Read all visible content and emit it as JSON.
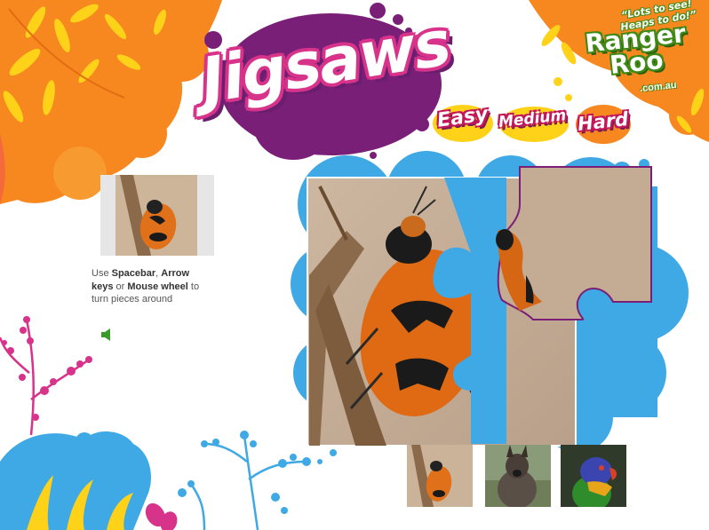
{
  "title": "Jigsaws",
  "difficulty": {
    "easy": "Easy",
    "medium": "Medium",
    "hard": "Hard"
  },
  "logo": {
    "tagline_line1": "“Lots to see!",
    "tagline_line2": "Heaps to do!”",
    "name_line1": "Ranger",
    "name_line2": "Roo",
    "domain": ".com.au"
  },
  "instructions": {
    "prefix": "Use ",
    "key1": "Spacebar",
    "sep1": ", ",
    "key2": "Arrow keys",
    "sep2": " or ",
    "key3": "Mouse wheel",
    "suffix": " to turn pieces around"
  },
  "icons": {
    "sound": "speaker-icon"
  },
  "thumbnails": [
    {
      "subject": "ladybird"
    },
    {
      "subject": "wallaby"
    },
    {
      "subject": "lorikeet"
    }
  ],
  "colors": {
    "orange_bg": "#f7871f",
    "yellow_leaf": "#ffd21a",
    "purple": "#7a1f78",
    "magenta": "#d8338b",
    "sky_blue": "#3fa9e6",
    "green": "#59b52a"
  }
}
